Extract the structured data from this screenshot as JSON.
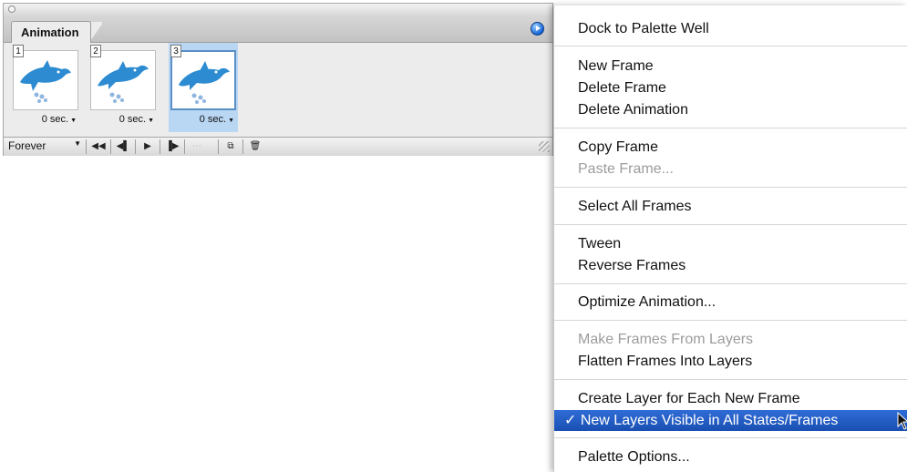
{
  "palette": {
    "tab_label": "Animation",
    "frames": [
      {
        "number": "1",
        "delay": "0 sec.",
        "selected": false
      },
      {
        "number": "2",
        "delay": "0 sec.",
        "selected": false
      },
      {
        "number": "3",
        "delay": "0 sec.",
        "selected": true
      }
    ],
    "loop_option": "Forever",
    "controls": [
      {
        "name": "first-frame-button",
        "icon": "◀◀",
        "enabled": true
      },
      {
        "name": "previous-frame-button",
        "icon": "◀▌",
        "enabled": true
      },
      {
        "name": "play-button",
        "icon": "▶",
        "enabled": true
      },
      {
        "name": "next-frame-button",
        "icon": "▐▶",
        "enabled": true
      },
      {
        "name": "tween-button",
        "icon": "⋯",
        "enabled": false
      },
      {
        "name": "duplicate-frame-button",
        "icon": "⧉",
        "enabled": true
      },
      {
        "name": "delete-frame-button",
        "icon": "🗑",
        "enabled": true
      }
    ]
  },
  "menu": {
    "items": [
      {
        "label": "Dock to Palette Well",
        "enabled": true
      },
      {
        "label": "New Frame",
        "enabled": true
      },
      {
        "label": "Delete Frame",
        "enabled": true
      },
      {
        "label": "Delete Animation",
        "enabled": true
      },
      {
        "label": "Copy Frame",
        "enabled": true
      },
      {
        "label": "Paste Frame...",
        "enabled": false
      },
      {
        "label": "Select All Frames",
        "enabled": true
      },
      {
        "label": "Tween",
        "enabled": true
      },
      {
        "label": "Reverse Frames",
        "enabled": true
      },
      {
        "label": "Optimize Animation...",
        "enabled": true
      },
      {
        "label": "Make Frames From Layers",
        "enabled": false
      },
      {
        "label": "Flatten Frames Into Layers",
        "enabled": true
      },
      {
        "label": "Create Layer for Each New Frame",
        "enabled": true
      },
      {
        "label": "✓ New Layers Visible in All States/Frames",
        "enabled": true,
        "checked": true,
        "highlighted": true
      },
      {
        "label": "Palette Options...",
        "enabled": true
      }
    ]
  },
  "colors": {
    "highlight": "#1f59c4",
    "selected_frame": "#b9d6f2",
    "dolphin": "#2d8cd1"
  }
}
